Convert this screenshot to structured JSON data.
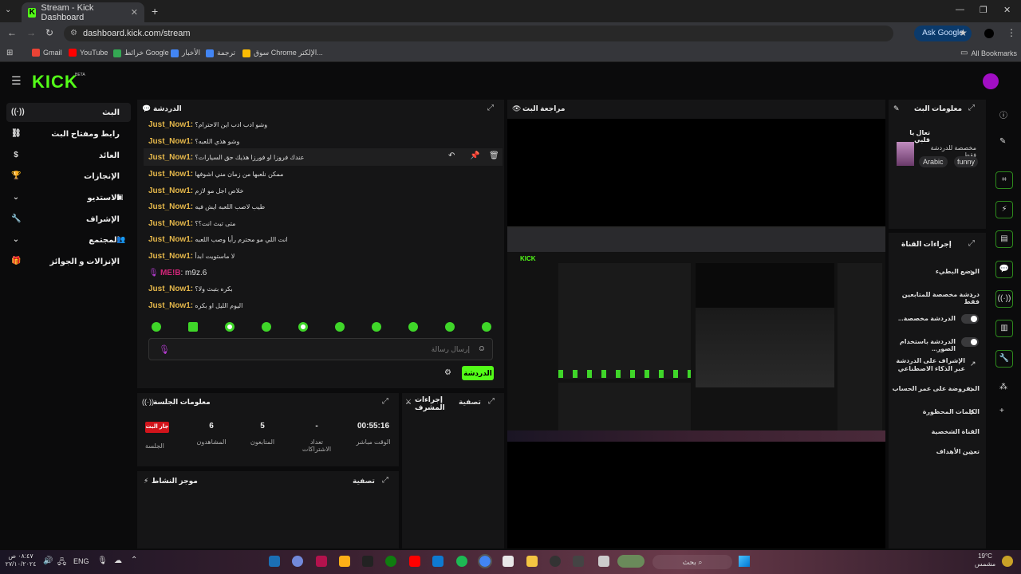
{
  "browser": {
    "tab_title": "Stream - Kick Dashboard",
    "url": "dashboard.kick.com/stream",
    "ask_google": "Ask Google",
    "bookmarks": [
      "Gmail",
      "YouTube",
      "خرائط Google",
      "الأخبار",
      "ترجمة",
      "سوق Chrome الإلكتر..."
    ],
    "all_bookmarks": "All Bookmarks"
  },
  "app": {
    "logo": "KICK",
    "beta": "BETA"
  },
  "sidebar": {
    "items": [
      {
        "label": "البث",
        "icon": "broadcast-icon"
      },
      {
        "label": "رابط ومفتاح البث",
        "icon": "link-icon"
      },
      {
        "label": "العائد",
        "icon": "dollar-icon"
      },
      {
        "label": "الإنجازات",
        "icon": "trophy-icon"
      },
      {
        "label": "الاستديو",
        "icon": "studio-icon"
      },
      {
        "label": "الإشراف",
        "icon": "wrench-icon"
      },
      {
        "label": "المجتمع",
        "icon": "community-icon"
      },
      {
        "label": "الإنزالات و الجوائز",
        "icon": "gift-icon"
      }
    ]
  },
  "chat": {
    "title": "الدردشة",
    "messages": [
      {
        "user": "Just_Now1:",
        "text": "وشو ادب ادب اين الاحترام؟"
      },
      {
        "user": "Just_Now1:",
        "text": "وشو هذي اللعبه؟"
      },
      {
        "user": "Just_Now1:",
        "text": "عندك فروزا او فورزا هذيك حق السيارات؟"
      },
      {
        "user": "Just_Now1:",
        "text": "ممكن نلعبها من زمان مني اشوفها"
      },
      {
        "user": "Just_Now1:",
        "text": "خلاص اجل مو لازم"
      },
      {
        "user": "Just_Now1:",
        "text": "طيب لاصب اللعبه ايش فيه"
      },
      {
        "user": "Just_Now1:",
        "text": "متى تبث انت؟؟"
      },
      {
        "user": "Just_Now1:",
        "text": "انت اللي مو محترم رأيا وصب اللعبه"
      },
      {
        "user": "Just_Now1:",
        "text": "لا ماستويت ابدأ"
      },
      {
        "user": "ΜΕ!Β",
        "text": ": m9z.6"
      },
      {
        "user": "Just_Now1:",
        "text": "بكره بتبث ولا؟"
      },
      {
        "user": "Just_Now1:",
        "text": "اليوم الليل او بكره"
      }
    ],
    "placeholder": "إرسال رسالة",
    "send_label": "الدردشة"
  },
  "session": {
    "title": "معلومات الجلسة",
    "live_badge": "جار البث",
    "session_label": "الجلسة",
    "viewers_value": "6",
    "viewers_label": "المشاهدون",
    "followers_value": "5",
    "followers_label": "المتابعون",
    "subs_value": "-",
    "subs_label": "تعداد الاشتراكات",
    "uptime_value": "00:55:16",
    "uptime_label": "الوقت مباشر"
  },
  "activity": {
    "title": "موجز النشاط",
    "filter": "تصفية"
  },
  "modactions": {
    "title": "إجراءات المشرف",
    "filter": "تصفية"
  },
  "preview": {
    "title": "مراجعة البث"
  },
  "streaminfo": {
    "title": "معلومات البث",
    "stream_title": "تعال يا قلبي",
    "subtitle": "مخصصة للدردشة فقط",
    "tags": [
      "Arabic",
      "funny"
    ]
  },
  "channel_actions": {
    "title": "إجراءات القناة",
    "items": [
      {
        "label": "الوضع البطيء",
        "control": "chevron"
      },
      {
        "label": "دردشة مخصصة للمتابعين فقط",
        "control": "chevron"
      },
      {
        "label": "الدردشة مخصصة...",
        "control": "toggle"
      },
      {
        "label": "الدردشة باستخدام الصور...",
        "control": "toggle"
      },
      {
        "label": "الإشراف على الدردشة عبر الذكاء الاصطناعي",
        "control": "external"
      },
      {
        "label": "المفروضة على عمر الحساب",
        "control": "chevron"
      },
      {
        "label": "الكلمات المحظورة",
        "control": "chevron"
      },
      {
        "label": "القناة الشخصية",
        "control": "none"
      },
      {
        "label": "تعيين الأهداف",
        "control": "chevron"
      }
    ]
  },
  "taskbar": {
    "time": "٠٨:٤٧ ص",
    "date": "٢٧/١٠/٢٠٢٤",
    "lang": "ENG",
    "search": "بحث",
    "temp": "19°C",
    "weather": "مشمس"
  },
  "colors": {
    "kick_green": "#53fc18",
    "username": "#e6b84a",
    "live_red": "#d1141b",
    "avatar": "#a10ec4"
  }
}
